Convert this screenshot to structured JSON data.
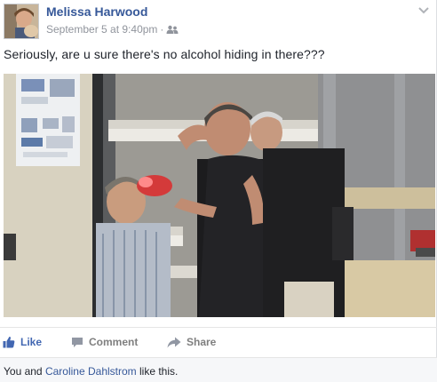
{
  "post": {
    "author": "Melissa Harwood",
    "timestamp": "September 5 at 9:40pm",
    "separator": "·",
    "audience_icon": "friends-icon",
    "message": "Seriously, are u sure there's no alcohol hiding in there???",
    "photo_description": "photo"
  },
  "actions": {
    "like_label": "Like",
    "comment_label": "Comment",
    "share_label": "Share"
  },
  "likes": {
    "prefix": "You and ",
    "friend_name": "Caroline Dahlstrom",
    "suffix": " like this."
  },
  "colors": {
    "link_blue": "#365899",
    "like_blue": "#4267b2",
    "meta_gray": "#90949c",
    "action_gray": "#7f7f7f",
    "likes_bg": "#f6f7f9"
  }
}
